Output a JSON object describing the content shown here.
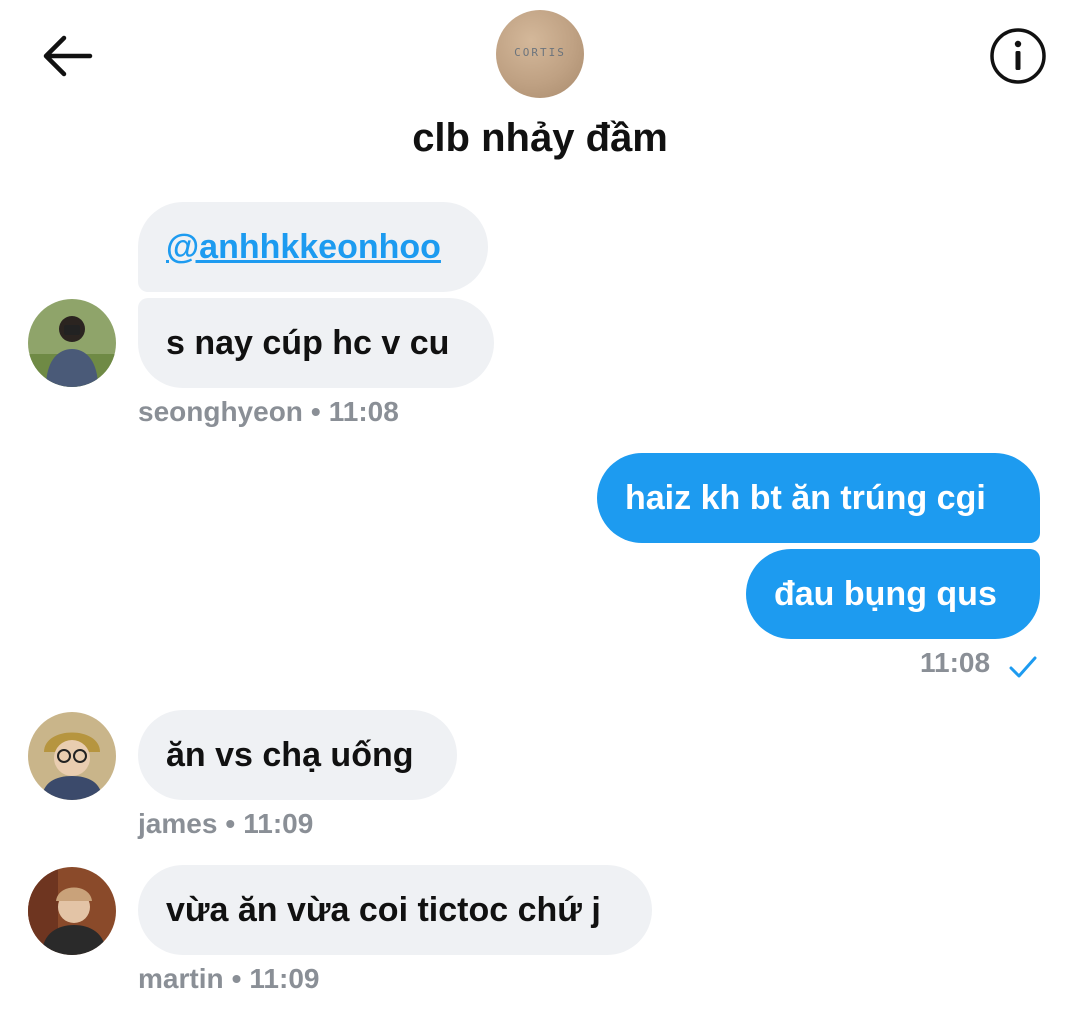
{
  "header": {
    "back_icon": "arrow-left-icon",
    "info_icon": "info-circle-icon",
    "group_name": "clb nhảy đầm",
    "group_avatar_logo": "CORTIS"
  },
  "messages": [
    {
      "sender": "seonghyeon",
      "direction": "incoming",
      "bubbles": [
        "@anhhkkeonhoo",
        "s nay cúp hc v cu"
      ],
      "time": "11:08"
    },
    {
      "sender": "me",
      "direction": "outgoing",
      "bubbles": [
        "haiz kh bt ăn trúng cgi",
        "đau bụng qus"
      ],
      "time": "11:08",
      "status_icon": "check-icon"
    },
    {
      "sender": "james",
      "direction": "incoming",
      "bubbles": [
        "ăn vs chạ uống"
      ],
      "time": "11:09"
    },
    {
      "sender": "martin",
      "direction": "incoming",
      "bubbles": [
        "vừa ăn vừa coi tictoc chứ j"
      ],
      "time": "11:09"
    }
  ],
  "meta_separator": "•",
  "colors": {
    "outgoing_bubble": "#1d9bf0",
    "incoming_bubble": "#eff1f4",
    "meta_text": "#8a8f96",
    "mention": "#1d9bf0"
  }
}
